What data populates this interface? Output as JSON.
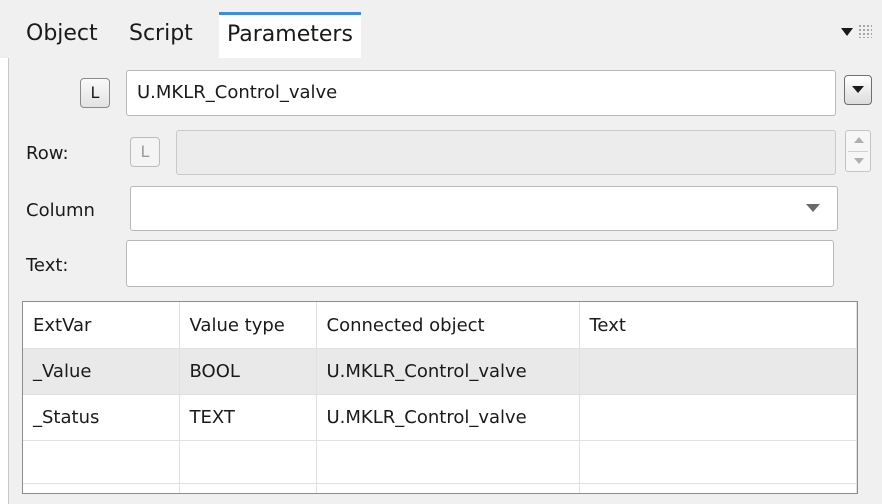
{
  "tabs": [
    {
      "label": "Object"
    },
    {
      "label": "Script"
    },
    {
      "label": "Parameters",
      "active": true
    }
  ],
  "object_row": {
    "l_button_label": "L",
    "value": "U.MKLR_Control_valve"
  },
  "row_field": {
    "label": "Row:",
    "l_button_label": "L",
    "value": ""
  },
  "column_field": {
    "label": "Column",
    "value": ""
  },
  "text_field": {
    "label": "Text:",
    "value": ""
  },
  "table": {
    "columns": [
      "ExtVar",
      "Value type",
      "Connected object",
      "Text"
    ],
    "rows": [
      {
        "extvar": "_Value",
        "value_type": "BOOL",
        "connected_object": "U.MKLR_Control_valve",
        "text": "",
        "selected": true
      },
      {
        "extvar": "_Status",
        "value_type": "TEXT",
        "connected_object": "U.MKLR_Control_valve",
        "text": ""
      },
      {
        "extvar": "",
        "value_type": "",
        "connected_object": "",
        "text": ""
      },
      {
        "extvar": "",
        "value_type": "",
        "connected_object": "",
        "text": ""
      }
    ]
  },
  "colors": {
    "accent": "#3c8fdc",
    "panel_bg": "#f0f0f0",
    "selected_row": "#e9e9e9"
  },
  "icons": {
    "tab_menu": "chevron-down-icon",
    "drag_handle": "grip-icon",
    "dropdown": "dropdown-arrow-icon",
    "spinner": "spinner-icon"
  }
}
